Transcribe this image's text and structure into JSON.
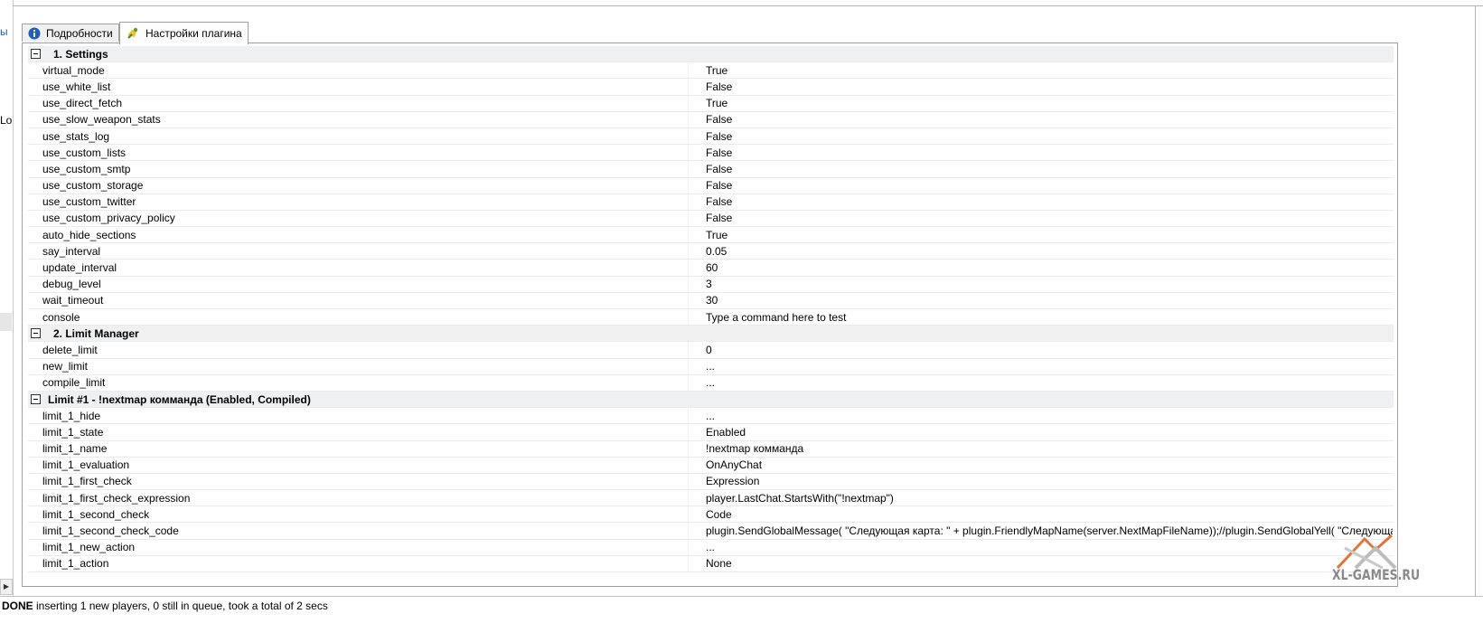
{
  "left_edge": {
    "fragment_a": "ы",
    "fragment_b": "Lo"
  },
  "tabs": [
    {
      "label": "Подробности",
      "icon": "info-icon",
      "active": false
    },
    {
      "label": "Настройки плагина",
      "icon": "plugin-settings-icon",
      "active": true
    }
  ],
  "sections": [
    {
      "title": "1. Settings",
      "rows": [
        {
          "name": "virtual_mode",
          "value": "True"
        },
        {
          "name": "use_white_list",
          "value": "False"
        },
        {
          "name": "use_direct_fetch",
          "value": "True"
        },
        {
          "name": "use_slow_weapon_stats",
          "value": "False"
        },
        {
          "name": "use_stats_log",
          "value": "False"
        },
        {
          "name": "use_custom_lists",
          "value": "False"
        },
        {
          "name": "use_custom_smtp",
          "value": "False"
        },
        {
          "name": "use_custom_storage",
          "value": "False"
        },
        {
          "name": "use_custom_twitter",
          "value": "False"
        },
        {
          "name": "use_custom_privacy_policy",
          "value": "False"
        },
        {
          "name": "auto_hide_sections",
          "value": "True"
        },
        {
          "name": "say_interval",
          "value": "0.05"
        },
        {
          "name": "update_interval",
          "value": "60"
        },
        {
          "name": "debug_level",
          "value": "3"
        },
        {
          "name": "wait_timeout",
          "value": "30"
        },
        {
          "name": "console",
          "value": "Type a command here to test"
        }
      ]
    },
    {
      "title": "2. Limit Manager",
      "rows": [
        {
          "name": "delete_limit",
          "value": "0"
        },
        {
          "name": "new_limit",
          "value": "..."
        },
        {
          "name": "compile_limit",
          "value": "..."
        }
      ]
    },
    {
      "title": "Limit #1 - !nextmap комманда (Enabled, Compiled)",
      "rows": [
        {
          "name": "limit_1_hide",
          "value": "..."
        },
        {
          "name": "limit_1_state",
          "value": "Enabled"
        },
        {
          "name": "limit_1_name",
          "value": "!nextmap комманда"
        },
        {
          "name": "limit_1_evaluation",
          "value": "OnAnyChat"
        },
        {
          "name": "limit_1_first_check",
          "value": "Expression"
        },
        {
          "name": "limit_1_first_check_expression",
          "value": "player.LastChat.StartsWith(\"!nextmap\")"
        },
        {
          "name": "limit_1_second_check",
          "value": "Code"
        },
        {
          "name": "limit_1_second_check_code",
          "value": "plugin.SendGlobalMessage( \"Следующая карта: \" + plugin.FriendlyMapName(server.NextMapFileName));//plugin.SendGlobalYell( \"Следующая карта"
        },
        {
          "name": "limit_1_new_action",
          "value": "..."
        },
        {
          "name": "limit_1_action",
          "value": "None"
        }
      ]
    }
  ],
  "status": {
    "bold": "DONE",
    "text": " inserting 1 new players, 0 still in queue, took a total of 2 secs"
  },
  "watermark": {
    "text": "XL-GAMES.RU"
  },
  "colors": {
    "category_bg": "#eef0f2",
    "border": "#a0a0a0",
    "info_blue": "#1f5fb4"
  }
}
